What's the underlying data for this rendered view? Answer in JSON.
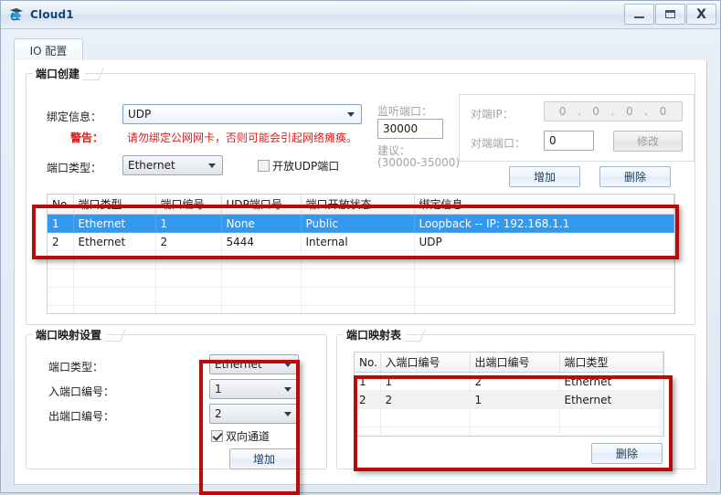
{
  "window": {
    "title": "Cloud1",
    "icon": "cloud-icon",
    "buttons": {
      "minimize": "minimize-icon",
      "maximize": "maximize-icon",
      "close": "X"
    }
  },
  "tabs": [
    {
      "label": "IO 配置"
    }
  ],
  "port_create": {
    "legend": "端口创建",
    "binding_label": "绑定信息：",
    "binding_value": "UDP",
    "warning_label": "警告：",
    "warning_text": "请勿绑定公网网卡，否则可能会引起网络瘫痪。",
    "port_type_label": "端口类型：",
    "port_type_value": "Ethernet",
    "open_udp_label": "开放UDP端口",
    "open_udp_checked": false,
    "listen_port_label": "监听端口：",
    "listen_port_value": "30000",
    "suggest_label": "建议：",
    "suggest_range": "(30000-35000)",
    "peer_ip_label": "对端IP：",
    "peer_ip_octets": [
      "0",
      "0",
      "0",
      "0"
    ],
    "peer_port_label": "对端端口：",
    "peer_port_value": "0",
    "modify_button": "修改",
    "add_button": "增加",
    "delete_button": "删除"
  },
  "port_table": {
    "columns": [
      "No.",
      "端口类型",
      "端口编号",
      "UDP端口号",
      "端口开放状态",
      "绑定信息"
    ],
    "rows": [
      {
        "no": "1",
        "type": "Ethernet",
        "number": "1",
        "udp_port": "None",
        "state": "Public",
        "binding": "Loopback -- IP: 192.168.1.1",
        "selected": true
      },
      {
        "no": "2",
        "type": "Ethernet",
        "number": "2",
        "udp_port": "5444",
        "state": "Internal",
        "binding": "UDP",
        "selected": false
      }
    ],
    "empty_rows": 4
  },
  "mapping_settings": {
    "legend": "端口映射设置",
    "port_type_label": "端口类型：",
    "port_type_value": "Ethernet",
    "in_port_label": "入端口编号：",
    "in_port_value": "1",
    "out_port_label": "出端口编号：",
    "out_port_value": "2",
    "duplex_label": "双向通道",
    "duplex_checked": true,
    "add_button": "增加"
  },
  "mapping_table": {
    "legend": "端口映射表",
    "columns": [
      "No.",
      "入端口编号",
      "出端口编号",
      "端口类型"
    ],
    "rows": [
      {
        "no": "1",
        "in_port": "1",
        "out_port": "2",
        "type": "Ethernet",
        "alt": false
      },
      {
        "no": "2",
        "in_port": "2",
        "out_port": "1",
        "type": "Ethernet",
        "alt": true
      }
    ],
    "empty_rows": 3,
    "delete_button": "删除"
  },
  "colors": {
    "annotation": "#bb0a0a",
    "selection": "#3399ee",
    "warning": "#e01b1b",
    "title": "#12437d"
  }
}
